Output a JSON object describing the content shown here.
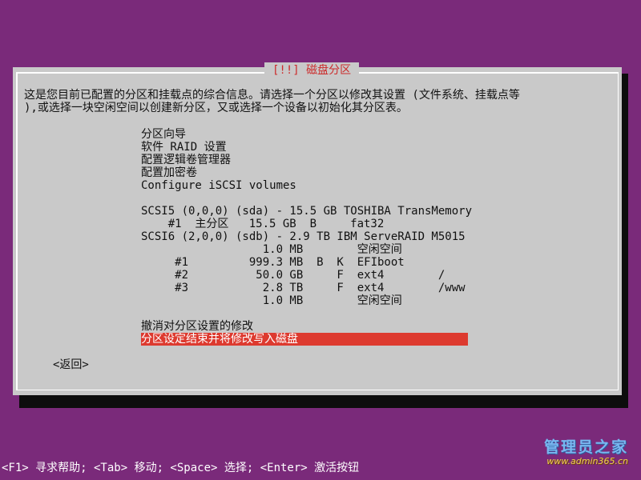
{
  "dialog": {
    "title": "[!!] 磁盘分区",
    "intro_line1": "这是您目前已配置的分区和挂载点的综合信息。请选择一个分区以修改其设置 (文件系统、挂载点等",
    "intro_line2": "),或选择一块空闲空间以创建新分区，又或选择一个设备以初始化其分区表。"
  },
  "menu": {
    "guided": "分区向导",
    "raid": "软件 RAID 设置",
    "lvm": "配置逻辑卷管理器",
    "crypto": "配置加密卷",
    "iscsi": "Configure iSCSI volumes"
  },
  "devices": {
    "disk1": "SCSI5 (0,0,0) (sda) - 15.5 GB TOSHIBA TransMemory",
    "disk1_p1": "    #1  主分区   15.5 GB  B     fat32",
    "disk2": "SCSI6 (2,0,0) (sdb) - 2.9 TB IBM ServeRAID M5015",
    "disk2_free1": "                  1.0 MB        空闲空间",
    "disk2_p1": "     #1         999.3 MB  B  K  EFIboot",
    "disk2_p2": "     #2          50.0 GB     F  ext4        /",
    "disk2_p3": "     #3           2.8 TB     F  ext4        /www",
    "disk2_free2": "                  1.0 MB        空闲空间"
  },
  "actions": {
    "undo": "撤消对分区设置的修改",
    "finish": "分区设定结束并将修改写入磁盘",
    "back": "<返回>"
  },
  "helpbar": {
    "text": "<F1> 寻求帮助; <Tab> 移动; <Space> 选择; <Enter> 激活按钮"
  },
  "watermark": {
    "name": "管理员之家",
    "url": "www.admin365.cn"
  },
  "colors": {
    "background": "#7a2a7a",
    "dialog": "#c9c9c9",
    "title": "#cc2c2c",
    "highlight": "#dd3a2f"
  }
}
